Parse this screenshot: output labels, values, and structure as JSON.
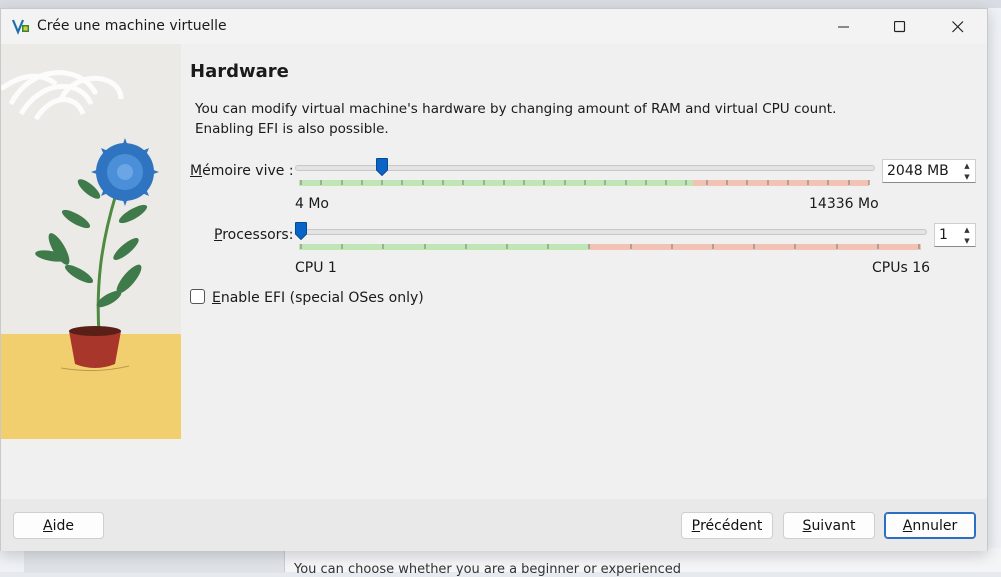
{
  "window": {
    "title": "Crée une machine virtuelle"
  },
  "page": {
    "heading": "Hardware",
    "description": "You can modify virtual machine's hardware by changing amount of RAM and virtual CPU count. Enabling EFI is also possible."
  },
  "memory": {
    "label_key": "M",
    "label_rest": "émoire vive :",
    "value": "2048 MB",
    "min_label": "4 Mo",
    "max_label": "14336 Mo",
    "min": 4,
    "max": 14336,
    "current": 2048
  },
  "processors": {
    "label_key": "P",
    "label_rest": "rocessors:",
    "value": "1",
    "min_label": "CPU 1",
    "max_label": "CPUs 16",
    "min": 1,
    "max": 16,
    "current": 1
  },
  "efi": {
    "label_key": "E",
    "label_rest": "nable EFI (special OSes only)",
    "checked": false
  },
  "buttons": {
    "help_key": "A",
    "help_rest": "ide",
    "back_key": "P",
    "back_rest": "récédent",
    "next_key": "S",
    "next_rest": "uivant",
    "cancel_key": "A",
    "cancel_rest": "nnuler"
  },
  "background": {
    "text": "You can choose whether you are a beginner or experienced"
  },
  "colors": {
    "accent": "#0a64c8",
    "ok_range": "#bfe6b4",
    "warn_range": "#f2c3b5",
    "sand": "#f2cf6e"
  }
}
